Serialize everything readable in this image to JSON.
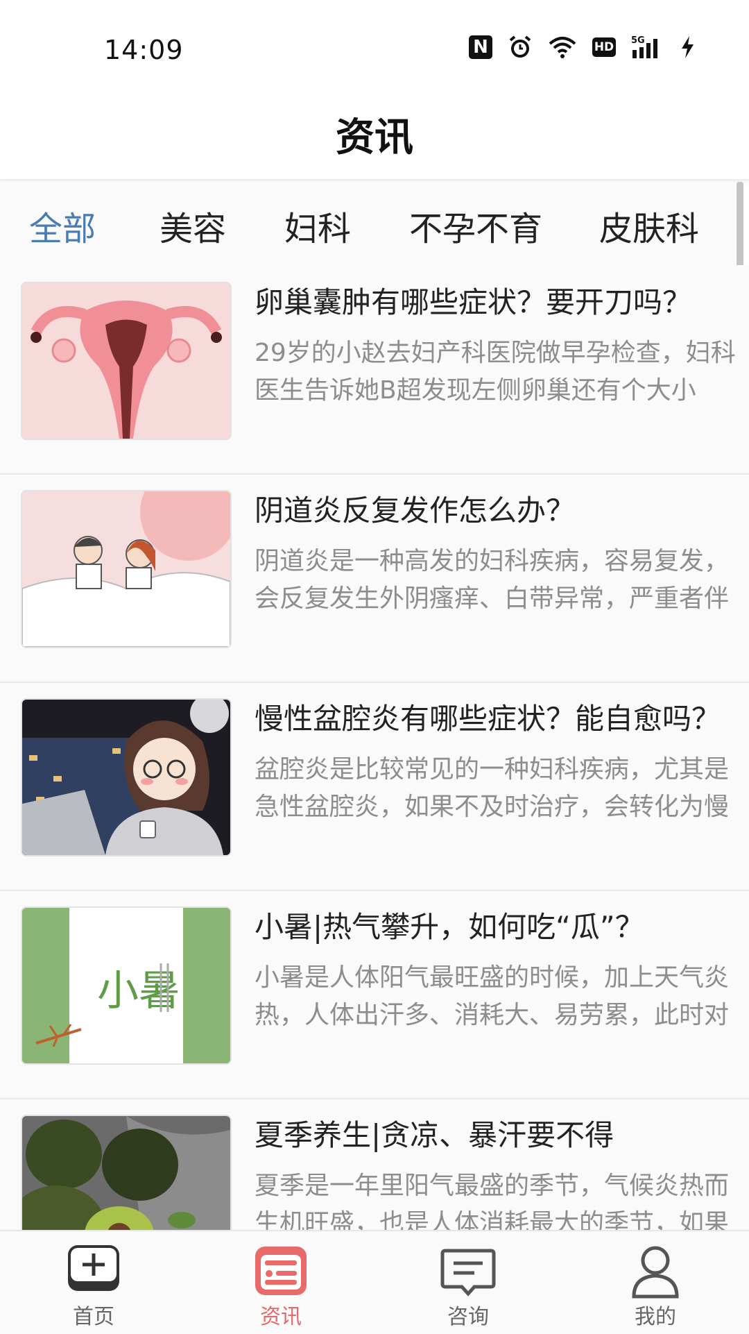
{
  "status_bar": {
    "time": "14:09",
    "icons": [
      "nfc-icon",
      "alarm-icon",
      "wifi-icon",
      "hd-icon",
      "signal-5g-icon",
      "battery-charging-icon"
    ],
    "nfc_text": "N",
    "hd_text": "HD",
    "network_text": "5G"
  },
  "header": {
    "title": "资讯"
  },
  "tabs": [
    {
      "label": "全部",
      "active": true
    },
    {
      "label": "美容",
      "active": false
    },
    {
      "label": "妇科",
      "active": false
    },
    {
      "label": "不孕不育",
      "active": false
    },
    {
      "label": "皮肤科",
      "active": false
    }
  ],
  "articles": [
    {
      "title": "卵巢囊肿有哪些症状？要开刀吗？",
      "summary": "29岁的小赵去妇产科医院做早孕检查，妇科医生告诉她B超发现左侧卵巢还有个大小",
      "thumb": "uterus-illustration"
    },
    {
      "title": "阴道炎反复发作怎么办？",
      "summary": "阴道炎是一种高发的妇科疾病，容易复发，会反复发生外阴瘙痒、白带异常，严重者伴",
      "thumb": "couple-in-bed-illustration"
    },
    {
      "title": "慢性盆腔炎有哪些症状？能自愈吗？",
      "summary": "盆腔炎是比较常见的一种妇科疾病，尤其是急性盆腔炎，如果不及时治疗，会转化为慢",
      "thumb": "tired-woman-at-night-illustration"
    },
    {
      "title": "小暑|热气攀升，如何吃“瓜”？",
      "summary": "小暑是人体阳气最旺盛的时候，加上天气炎热，人体出汗多、消耗大、易劳累，此时对",
      "thumb": "xiaoshu-poster",
      "thumb_text": "小暑"
    },
    {
      "title": "夏季养生|贪凉、暴汗要不得",
      "summary": "夏季是一年里阳气最盛的季节，气候炎热而生机旺盛，也是人体消耗最大的季节，如果",
      "thumb": "avocado-photo"
    }
  ],
  "bottom_nav": [
    {
      "label": "首页",
      "icon": "home-add-icon",
      "active": false
    },
    {
      "label": "资讯",
      "icon": "news-icon",
      "active": true
    },
    {
      "label": "咨询",
      "icon": "chat-icon",
      "active": false
    },
    {
      "label": "我的",
      "icon": "profile-icon",
      "active": false
    }
  ],
  "colors": {
    "tab_active": "#4a7cb0",
    "nav_active": "#e36a6a",
    "summary_text": "#8d8d8d"
  }
}
